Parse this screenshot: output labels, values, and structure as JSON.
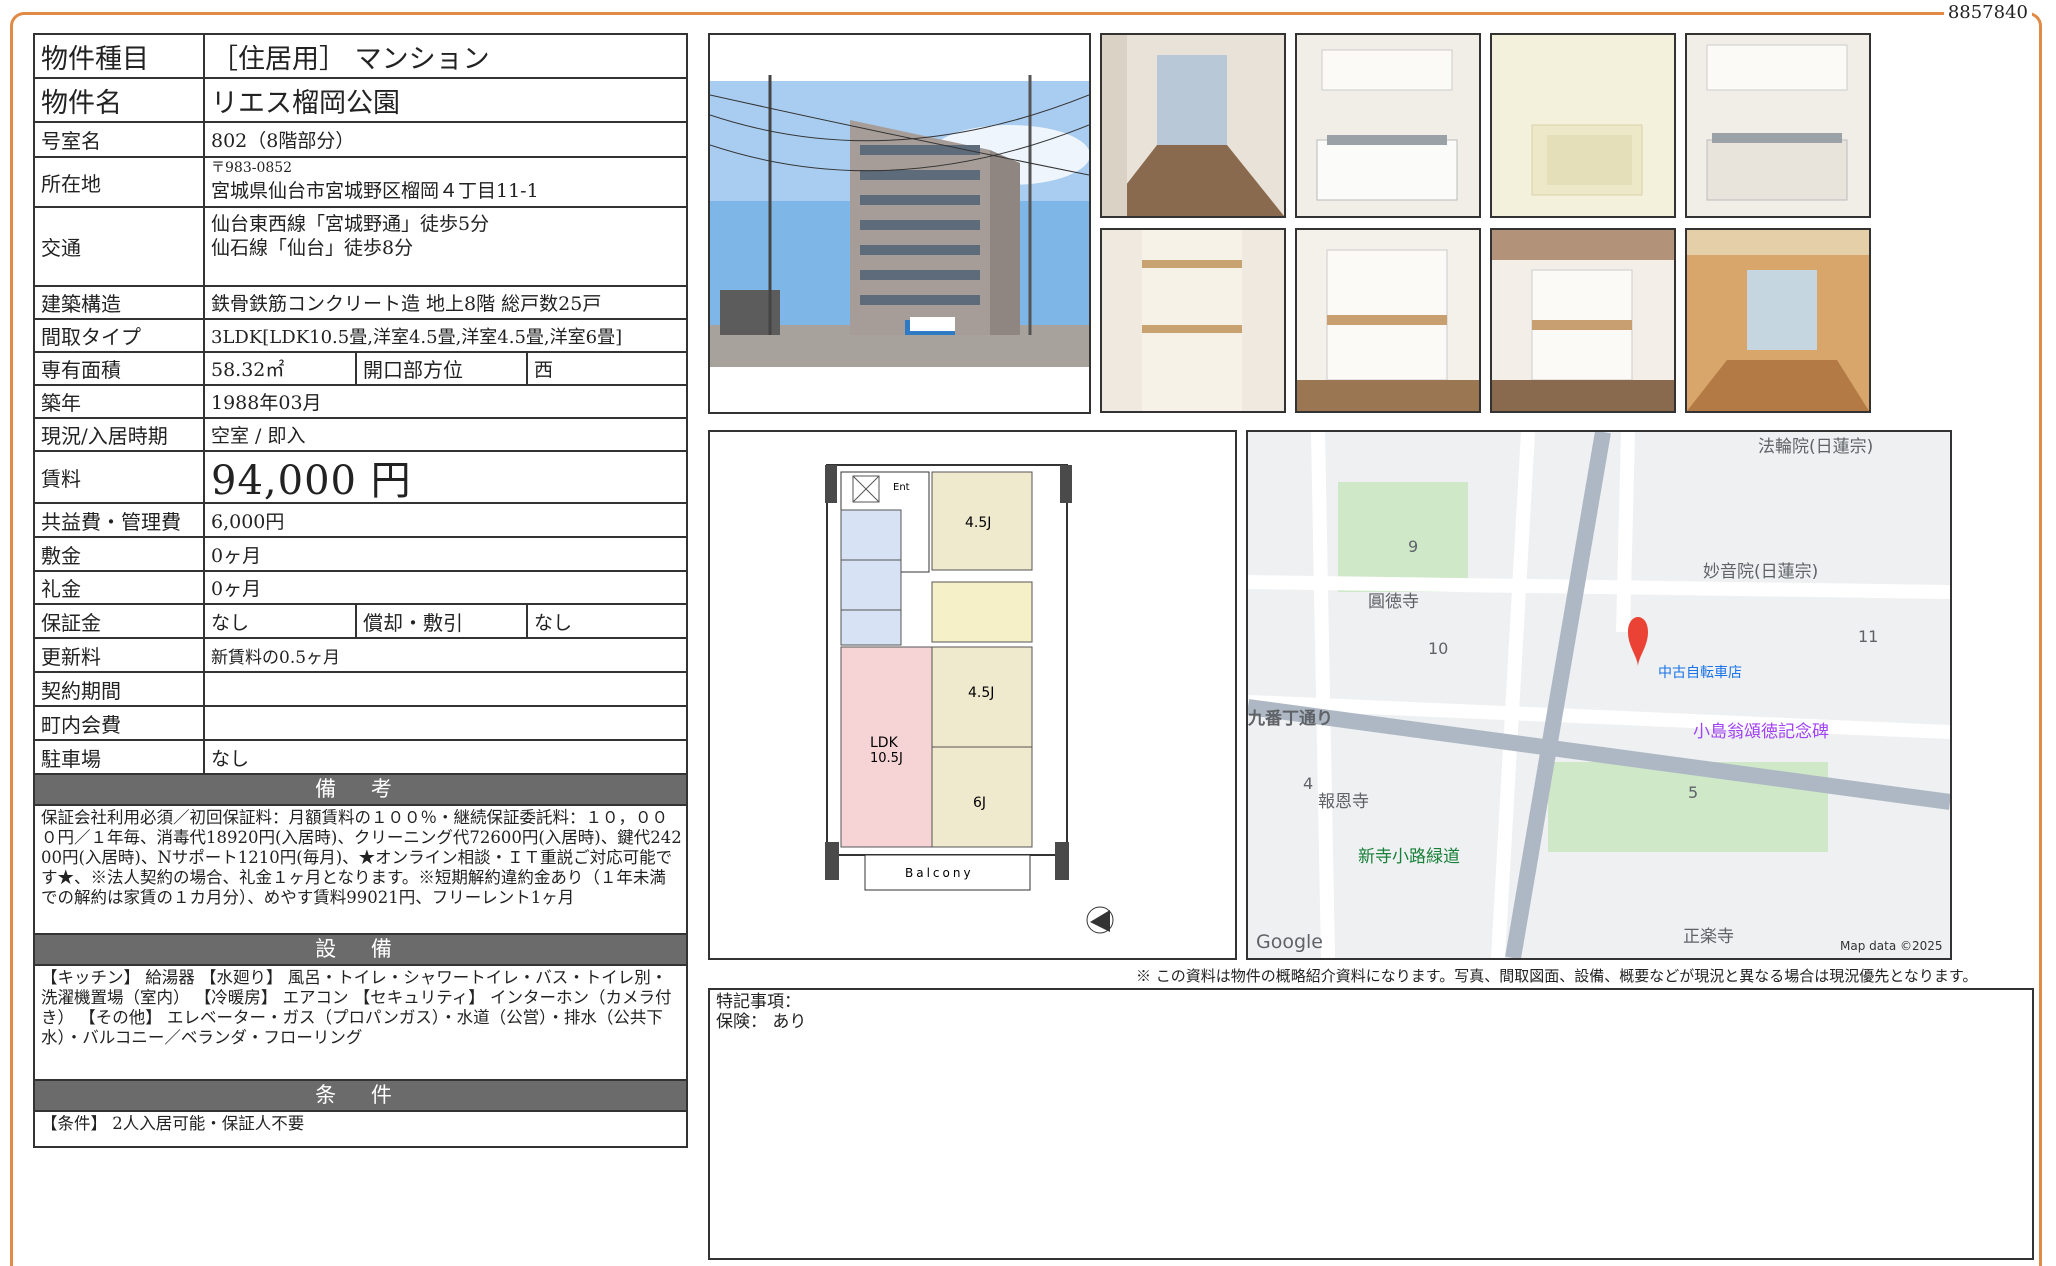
{
  "doc_id": "8857840",
  "spec": {
    "type_label": "物件種目",
    "type_value": "［住居用］ マンション",
    "name_label": "物件名",
    "name_value": "リエス榴岡公園",
    "room_label": "号室名",
    "room_value": "802（8階部分）",
    "address_label": "所在地",
    "zip": "〒983-0852",
    "address": "宮城県仙台市宮城野区榴岡４丁目11-1",
    "traffic_label": "交通",
    "traffic_1": "仙台東西線「宮城野通」徒歩5分",
    "traffic_2": "仙石線「仙台」徒歩8分",
    "structure_label": "建築構造",
    "structure_value": "鉄骨鉄筋コンクリート造 地上8階 総戸数25戸",
    "layout_label": "間取タイプ",
    "layout_value": "3LDK[LDK10.5畳,洋室4.5畳,洋室4.5畳,洋室6畳]",
    "area_label": "専有面積",
    "area_value": "58.32㎡",
    "direction_label": "開口部方位",
    "direction_value": "西",
    "built_label": "築年",
    "built_value": "1988年03月",
    "status_label": "現況/入居時期",
    "status_value": "空室 / 即入",
    "rent_label": "賃料",
    "rent_value": "94,000 円",
    "fee_label": "共益費・管理費",
    "fee_value": "6,000円",
    "deposit_label": "敷金",
    "deposit_value": "0ヶ月",
    "key_label": "礼金",
    "key_value": "0ヶ月",
    "guarantee_label": "保証金",
    "guarantee_value": "なし",
    "amort_label": "償却・敷引",
    "amort_value": "なし",
    "renewal_label": "更新料",
    "renewal_value": "新賃料の0.5ヶ月",
    "contract_label": "契約期間",
    "contract_value": "",
    "town_label": "町内会費",
    "town_value": "",
    "parking_label": "駐車場",
    "parking_value": "なし"
  },
  "remarks_head": "備 考",
  "remarks_text": "保証会社利用必須／初回保証料：月額賃料の１００％・継続保証委託料：１０，０００円／１年毎、消毒代18920円(入居時)、クリーニング代72600円(入居時)、鍵代24200円(入居時)、Nサポート1210円(毎月)、★オンライン相談・ＩＴ重説ご対応可能です★、※法人契約の場合、礼金１ヶ月となります。※短期解約違約金あり（１年未満での解約は家賃の１カ月分）、めやす賃料99021円、フリーレント1ヶ月",
  "equip_head": "設 備",
  "equip_text": "【キッチン】 給湯器 【水廻り】 風呂・トイレ・シャワートイレ・バス・トイレ別・洗濯機置場（室内） 【冷暖房】 エアコン 【セキュリティ】 インターホン（カメラ付き） 【その他】 エレベーター・ガス（プロパンガス）・水道（公営）・排水（公共下水）・バルコニー／ベランダ・フローリング",
  "cond_head": "条 件",
  "cond_text": "【条件】 2人入居可能・保証人不要",
  "floorplan": {
    "labels": [
      "Ent",
      "4.5J",
      "4.5J",
      "LDK",
      "10.5J",
      "6J",
      "Balcony"
    ]
  },
  "map": {
    "places": [
      "法輪院(日蓮宗)",
      "妙音院(日蓮宗)",
      "圓徳寺",
      "中古自転車店",
      "九番丁通り",
      "小島翁頌徳記念碑",
      "報恩寺",
      "新寺小路緑道",
      "正楽寺"
    ],
    "blocks": [
      "9",
      "10",
      "11",
      "4",
      "5"
    ],
    "logo": "Google",
    "attribution": "Map data ©2025"
  },
  "note": "※ この資料は物件の概略紹介資料になります。写真、間取図面、設備、概要などが現況と異なる場合は現況優先となります。",
  "special_label": "特記事項：",
  "insurance": "保険： あり"
}
